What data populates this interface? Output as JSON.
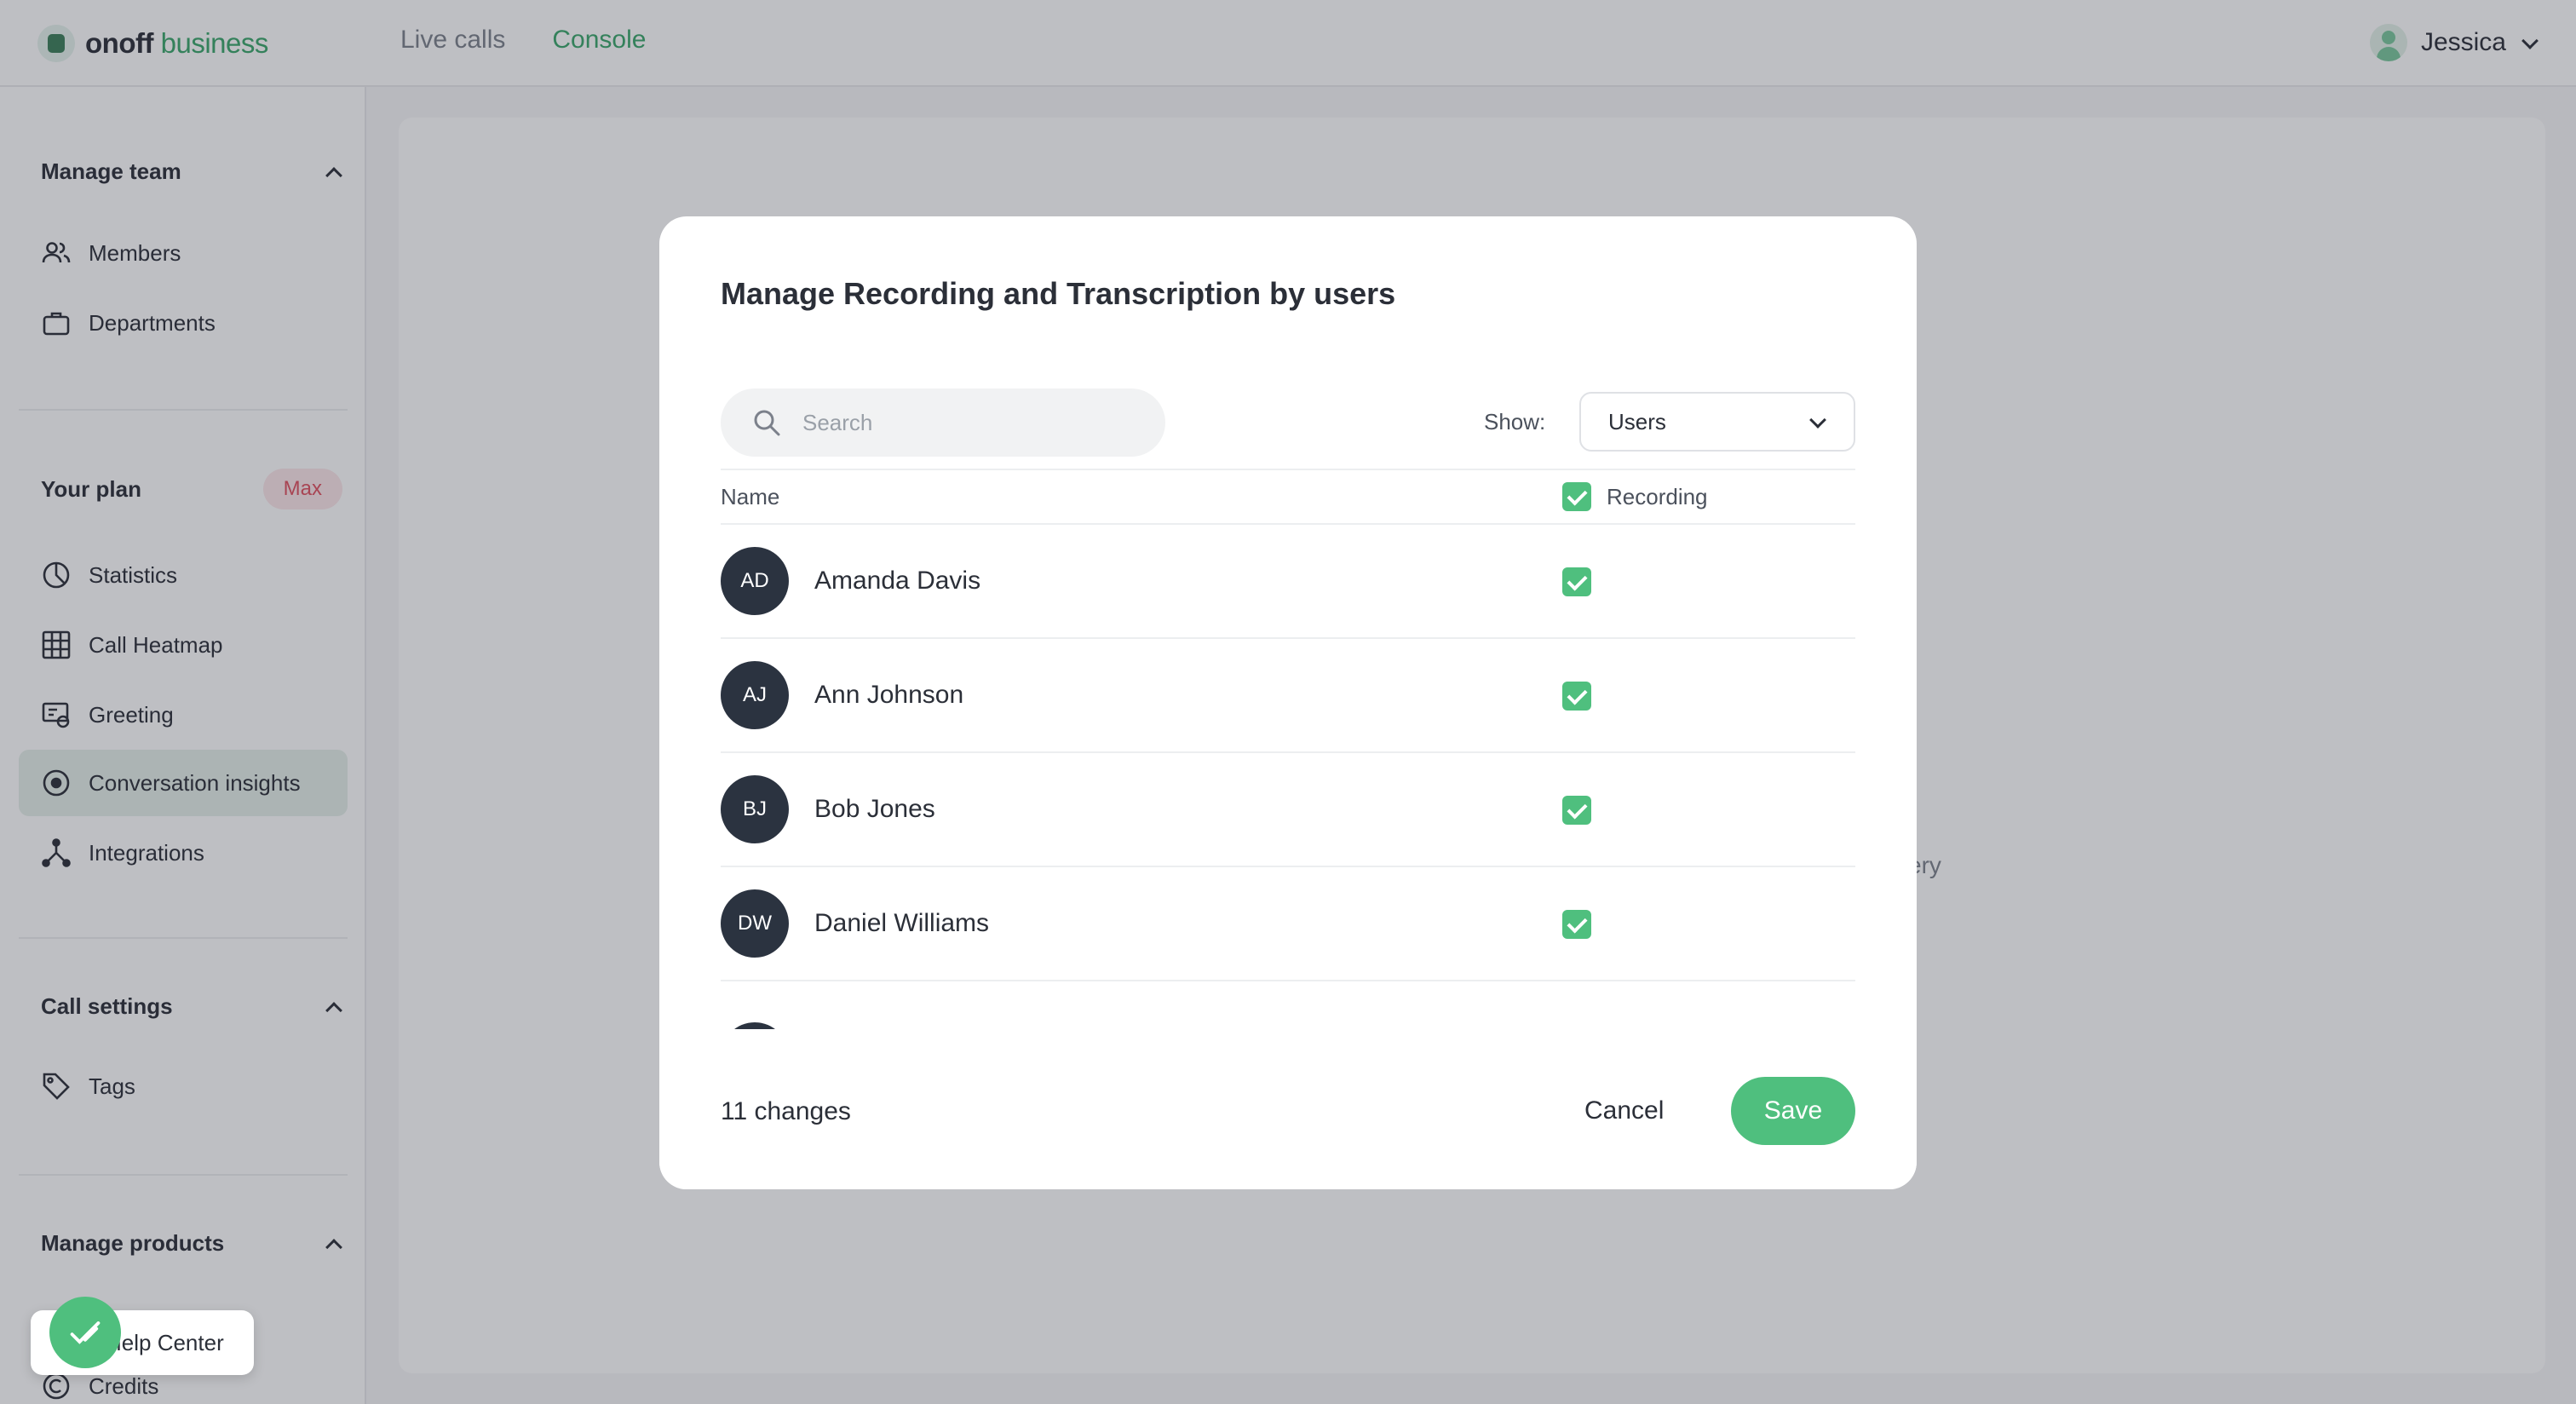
{
  "app": {
    "logo_text_bold": "onoff",
    "logo_text_light": "business",
    "nav": [
      {
        "label": "Live calls",
        "active": false
      },
      {
        "label": "Console",
        "active": true
      }
    ],
    "user_name": "Jessica"
  },
  "sidebar": {
    "manage_team": {
      "title": "Manage team",
      "items": [
        {
          "label": "Members",
          "icon": "members-icon"
        },
        {
          "label": "Departments",
          "icon": "briefcase-icon"
        }
      ]
    },
    "plan": {
      "title": "Your plan",
      "badge": "Max",
      "items": [
        {
          "label": "Statistics",
          "icon": "pie-chart-icon"
        },
        {
          "label": "Call Heatmap",
          "icon": "grid-icon"
        },
        {
          "label": "Greeting",
          "icon": "greeting-icon"
        },
        {
          "label": "Conversation insights",
          "icon": "target-icon",
          "active": true
        },
        {
          "label": "Integrations",
          "icon": "integrations-icon"
        }
      ]
    },
    "call_settings": {
      "title": "Call settings",
      "items": [
        {
          "label": "Tags",
          "icon": "tag-icon"
        }
      ]
    },
    "manage_products": {
      "title": "Manage products",
      "items": [
        {
          "label": "Credits",
          "icon": "credits-icon"
        }
      ]
    },
    "help_label": "Help Center"
  },
  "content": {
    "partial_text": "ery"
  },
  "modal": {
    "title": "Manage Recording and Transcription by users",
    "search_placeholder": "Search",
    "show_label": "Show:",
    "show_value": "Users",
    "columns": {
      "name": "Name",
      "recording": "Recording"
    },
    "users": [
      {
        "initials": "AD",
        "name": "Amanda Davis",
        "recording": true
      },
      {
        "initials": "AJ",
        "name": "Ann Johnson",
        "recording": true
      },
      {
        "initials": "BJ",
        "name": "Bob Jones",
        "recording": true
      },
      {
        "initials": "DW",
        "name": "Daniel Williams",
        "recording": true
      }
    ],
    "changes": "11 changes",
    "cancel_label": "Cancel",
    "save_label": "Save"
  },
  "colors": {
    "accent": "#4fbf7e",
    "avatar_bg": "#2b3340",
    "badge_text": "#e0505f"
  }
}
